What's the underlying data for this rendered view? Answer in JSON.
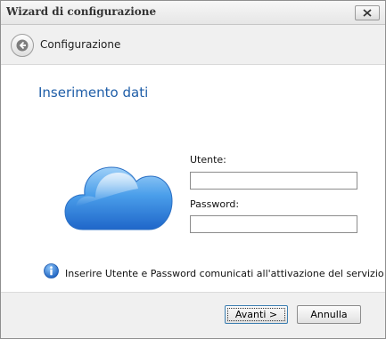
{
  "window": {
    "title": "Wizard di configurazione"
  },
  "header": {
    "breadcrumb": "Configurazione"
  },
  "main": {
    "section_title": "Inserimento dati",
    "user_label": "Utente:",
    "user_value": "",
    "password_label": "Password:",
    "password_value": "",
    "info_text": "Inserire Utente e Password comunicati all'attivazione del servizio"
  },
  "footer": {
    "next_label": "Avanti >",
    "cancel_label": "Annulla"
  },
  "icons": {
    "close": "close-icon",
    "back": "back-arrow-icon",
    "cloud": "cloud-icon",
    "info": "info-icon"
  },
  "colors": {
    "accent": "#1f5ea8",
    "cloud": "#3a8de0"
  }
}
